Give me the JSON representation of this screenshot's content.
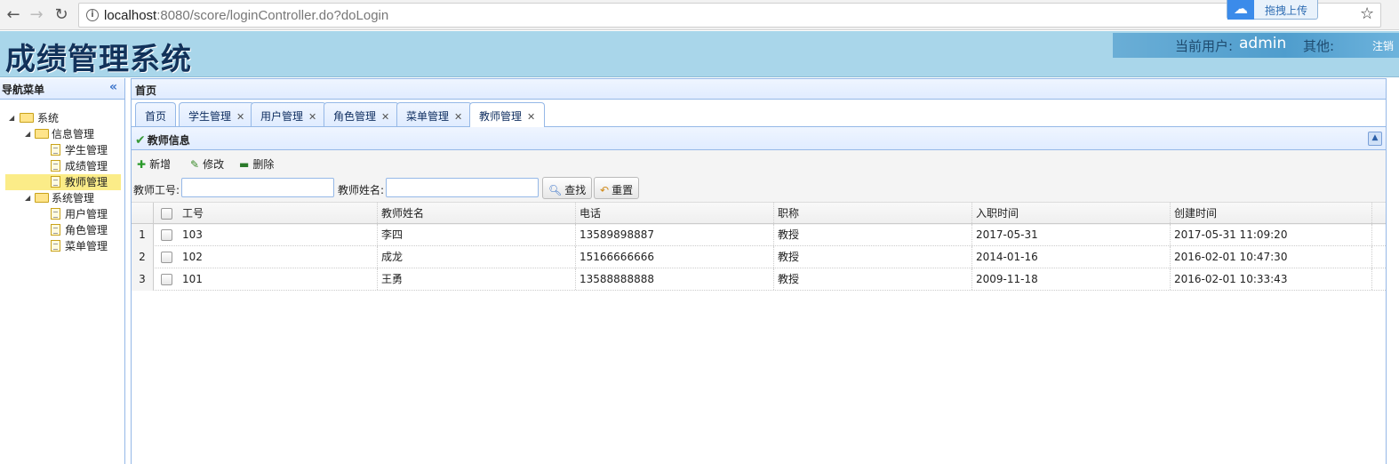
{
  "browser": {
    "url_host": "localhost",
    "url_rest": ":8080/score/loginController.do?doLogin",
    "upload_label": "拖拽上传"
  },
  "header": {
    "title": "成绩管理系统",
    "user_label": "当前用户:",
    "user_name": "admin",
    "other_label": "其他:",
    "logout": "注销"
  },
  "sidebar": {
    "title": "导航菜单",
    "tree": [
      {
        "label": "系统",
        "level": 0,
        "type": "folder"
      },
      {
        "label": "信息管理",
        "level": 1,
        "type": "folder"
      },
      {
        "label": "学生管理",
        "level": 2,
        "type": "file"
      },
      {
        "label": "成绩管理",
        "level": 2,
        "type": "file"
      },
      {
        "label": "教师管理",
        "level": 2,
        "type": "file",
        "selected": true
      },
      {
        "label": "系统管理",
        "level": 1,
        "type": "folder"
      },
      {
        "label": "用户管理",
        "level": 2,
        "type": "file"
      },
      {
        "label": "角色管理",
        "level": 2,
        "type": "file"
      },
      {
        "label": "菜单管理",
        "level": 2,
        "type": "file"
      }
    ]
  },
  "main": {
    "title": "首页",
    "tabs": [
      {
        "label": "首页",
        "closable": false
      },
      {
        "label": "学生管理",
        "closable": true
      },
      {
        "label": "用户管理",
        "closable": true
      },
      {
        "label": "角色管理",
        "closable": true
      },
      {
        "label": "菜单管理",
        "closable": true
      },
      {
        "label": "教师管理",
        "closable": true,
        "active": true
      }
    ],
    "panel_title": "教师信息",
    "toolbar": {
      "add": "新增",
      "edit": "修改",
      "delete": "删除"
    },
    "search": {
      "id_label": "教师工号:",
      "name_label": "教师姓名:",
      "search_btn": "查找",
      "reset_btn": "重置"
    },
    "columns": [
      "工号",
      "教师姓名",
      "电话",
      "职称",
      "入职时间",
      "创建时间"
    ],
    "rows": [
      {
        "num": "1",
        "cells": [
          "103",
          "李四",
          "13589898887",
          "教授",
          "2017-05-31",
          "2017-05-31 11:09:20"
        ]
      },
      {
        "num": "2",
        "cells": [
          "102",
          "成龙",
          "15166666666",
          "教授",
          "2014-01-16",
          "2016-02-01 10:47:30"
        ]
      },
      {
        "num": "3",
        "cells": [
          "101",
          "王勇",
          "13588888888",
          "教授",
          "2009-11-18",
          "2016-02-01 10:33:43"
        ]
      }
    ]
  },
  "colors": {
    "header_bg": "#a9d6ea",
    "title_color": "#12325a",
    "border": "#95b8e7",
    "selected_node": "#fbec88"
  }
}
